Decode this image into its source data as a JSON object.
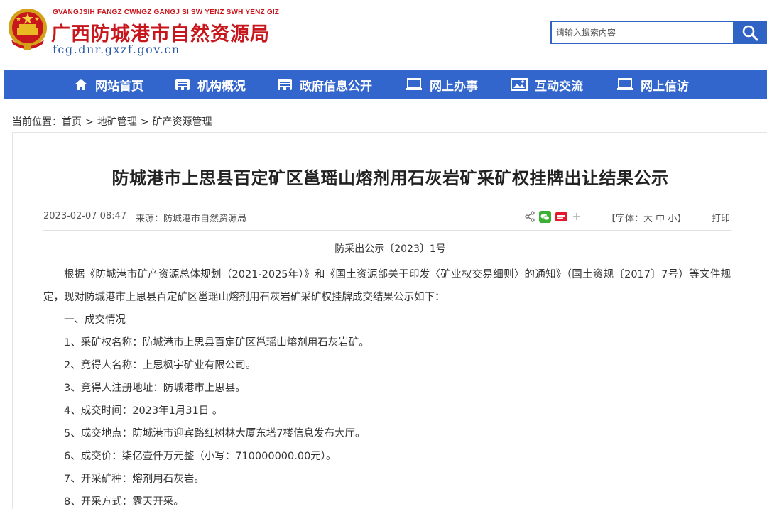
{
  "header": {
    "site_name_en": "GVANGJSIH FANGZ CWNGZ GANGJ SI SW YENZ SWH YENZ GIZ",
    "site_name_cn": "广西防城港市自然资源局",
    "site_url": "fcg.dnr.gxzf.gov.cn",
    "emblem_icon": "national-emblem-icon",
    "brand_color": "#c8161d"
  },
  "search": {
    "placeholder": "请输入搜索内容",
    "icon": "search-icon",
    "accent_color": "#2f63c4"
  },
  "nav": {
    "items": [
      {
        "label": "网站首页",
        "icon": "home-icon"
      },
      {
        "label": "机构概况",
        "icon": "org-icon"
      },
      {
        "label": "政府信息公开",
        "icon": "info-icon"
      },
      {
        "label": "网上办事",
        "icon": "laptop-icon"
      },
      {
        "label": "互动交流",
        "icon": "image-icon"
      },
      {
        "label": "网上信访",
        "icon": "laptop-icon"
      }
    ],
    "bg_color": "#3366cc"
  },
  "breadcrumb": {
    "prefix": "当前位置：",
    "items": [
      "首页",
      "地矿管理",
      "矿产资源管理"
    ],
    "separator": ">"
  },
  "article": {
    "title": "防城港市上思县百定矿区邕瑶山熔剂用石灰岩矿采矿权挂牌出让结果公示",
    "date": "2023-02-07 08:47",
    "source": "来源：防城港市自然资源局",
    "share_icons": [
      "share-icon",
      "wechat-icon",
      "weibo-icon",
      "plus-icon"
    ],
    "font_control": {
      "open": "【字体：",
      "large": "大",
      "medium": "中",
      "small": "小",
      "close": "】"
    },
    "print_label": "打印",
    "doc_number": "防采出公示〔2023〕1号",
    "intro": "根据《防城港市矿产资源总体规划（2021-2025年）》和《国土资源部关于印发〈矿业权交易细则〉的通知》（国土资规〔2017〕7号）等文件规定，现对防城港市上思县百定矿区邕瑶山熔剂用石灰岩矿采矿权挂牌成交结果公示如下：",
    "section_1": "一、成交情况",
    "items": [
      "1、采矿权名称：防城港市上思县百定矿区邕瑶山熔剂用石灰岩矿。",
      "2、竞得人名称：上思枫宇矿业有限公司。",
      "3、竞得人注册地址：防城港市上思县。",
      "4、成交时间：2023年1月31日 。",
      "5、成交地点：防城港市迎宾路红树林大厦东塔7楼信息发布大厅。",
      "6、成交价：柒亿壹仟万元整（小写：710000000.00元）。",
      "7、开采矿种：熔剂用石灰岩。",
      "8、开采方式：露天开采。"
    ]
  }
}
